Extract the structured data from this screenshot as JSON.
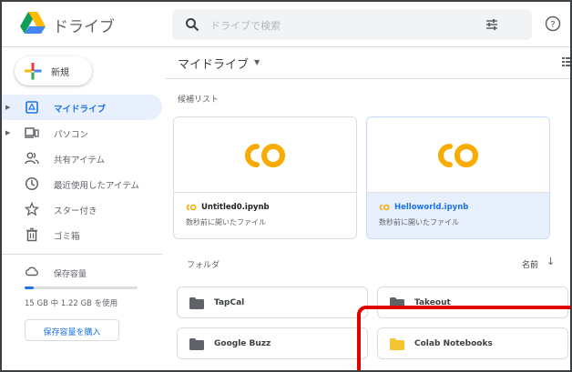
{
  "header": {
    "app_title": "ドライブ",
    "search_placeholder": "ドライブで検索"
  },
  "sidebar": {
    "new_label": "新規",
    "items": [
      {
        "label": "マイドライブ",
        "icon": "my-drive-icon",
        "active": true,
        "expandable": true
      },
      {
        "label": "パソコン",
        "icon": "computer-icon",
        "active": false,
        "expandable": true
      },
      {
        "label": "共有アイテム",
        "icon": "shared-icon",
        "active": false,
        "expandable": false
      },
      {
        "label": "最近使用したアイテム",
        "icon": "recent-icon",
        "active": false,
        "expandable": false
      },
      {
        "label": "スター付き",
        "icon": "star-icon",
        "active": false,
        "expandable": false
      },
      {
        "label": "ゴミ箱",
        "icon": "trash-icon",
        "active": false,
        "expandable": false
      }
    ],
    "storage": {
      "label": "保存容量",
      "usage": "15 GB 中 1.22 GB を使用",
      "used_fraction": 0.081,
      "buy_label": "保存容量を購入"
    }
  },
  "main": {
    "title": "マイドライブ",
    "suggested_label": "候補リスト",
    "files": [
      {
        "name": "Untitled0.ipynb",
        "subtitle": "数秒前に開いたファイル",
        "selected": false
      },
      {
        "name": "Helloworld.ipynb",
        "subtitle": "数秒前に開いたファイル",
        "selected": true
      }
    ],
    "folders_label": "フォルダ",
    "sort_label": "名前",
    "folders": [
      {
        "name": "TapCal",
        "color": "#5f6368"
      },
      {
        "name": "Takeout",
        "color": "#5f6368"
      },
      {
        "name": "Google Buzz",
        "color": "#5f6368"
      },
      {
        "name": "Colab Notebooks",
        "color": "#f4c430"
      }
    ]
  },
  "colors": {
    "accent": "#1a73e8",
    "active_bg": "#e8f0fe",
    "colab_orange": "#f9ab00",
    "highlight_red": "#e00000"
  }
}
